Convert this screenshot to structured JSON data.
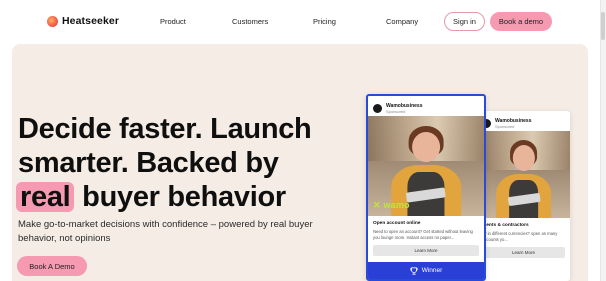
{
  "brand": {
    "name": "Heatseeker"
  },
  "nav": {
    "links": [
      "Product",
      "Customers",
      "Pricing",
      "Company"
    ],
    "signin_label": "Sign in",
    "demo_label": "Book a demo"
  },
  "hero": {
    "headline_line1": "Decide faster. Launch",
    "headline_line2": "smarter. Backed by",
    "headline_highlight": "real",
    "headline_line3_rest": " buyer behavior",
    "subtext": "Make go-to-market decisions with confidence – powered by real buyer behavior, not opinions",
    "cta_label": "Book A Demo"
  },
  "ad_front": {
    "account_name": "Wamobusiness",
    "account_sub": "Sponsored",
    "brand_watermark": "wamo",
    "title": "Open account online",
    "description": "Need to open an account? Get started without leaving you lounge room. Instant access no paper...",
    "learn_label": "Learn More",
    "winner_label": "Winner"
  },
  "ad_back": {
    "account_name": "Wamobusiness",
    "account_sub": "Sponsored",
    "title": "ments & contractors",
    "description": "ay in different currencies? open as many accounts yo...",
    "learn_label": "Learn More"
  },
  "colors": {
    "accent_pink": "#f59ab1",
    "hero_bg": "#f5ede5",
    "winner_blue": "#2a3fd6",
    "wamo_green": "#bde83a"
  }
}
